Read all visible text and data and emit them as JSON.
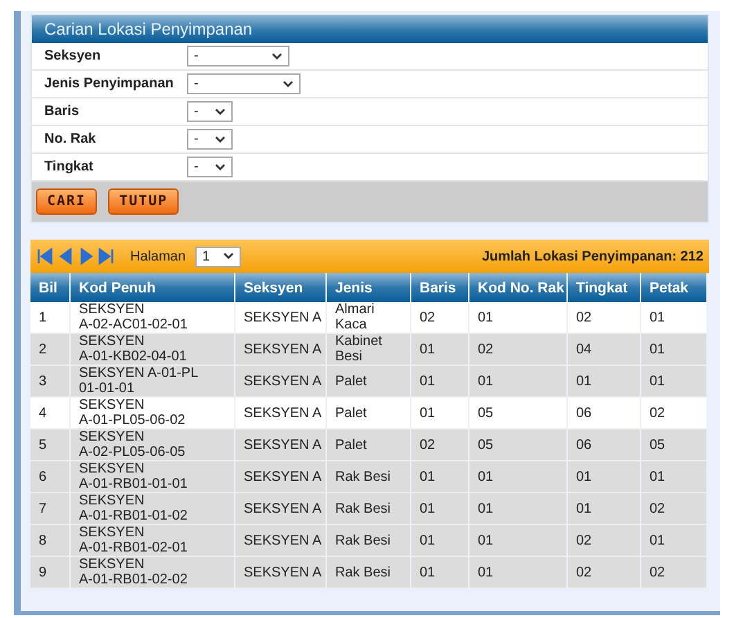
{
  "search_panel": {
    "title": "Carian Lokasi Penyimpanan",
    "fields": [
      {
        "label": "Seksyen",
        "value": "-"
      },
      {
        "label": "Jenis Penyimpanan",
        "value": "-"
      },
      {
        "label": "Baris",
        "value": "-"
      },
      {
        "label": "No. Rak",
        "value": "-"
      },
      {
        "label": "Tingkat",
        "value": "-"
      }
    ],
    "buttons": [
      "CARI",
      "TUTUP"
    ]
  },
  "pager": {
    "page_label": "Halaman",
    "page": "1",
    "total": "Jumlah Lokasi Penyimpanan: 212"
  },
  "table": {
    "columns": [
      "Bil",
      "Kod Penuh",
      "Seksyen",
      "Jenis",
      "Baris",
      "Kod No. Rak",
      "Tingkat",
      "Petak"
    ],
    "rows": [
      {
        "highlighted": true,
        "cells": [
          "1",
          "SEKSYEN\nA-02-AC01-02-01",
          "SEKSYEN A",
          "Almari\nKaca",
          "02",
          "01",
          "02",
          "01"
        ]
      },
      {
        "highlighted": false,
        "cells": [
          "2",
          "SEKSYEN\nA-01-KB02-04-01",
          "SEKSYEN A",
          "Kabinet\nBesi",
          "01",
          "02",
          "04",
          "01"
        ]
      },
      {
        "highlighted": false,
        "cells": [
          "3",
          "SEKSYEN A-01-PL\n01-01-01",
          "SEKSYEN A",
          "Palet",
          "01",
          "01",
          "01",
          "01"
        ]
      },
      {
        "highlighted": true,
        "cells": [
          "4",
          "SEKSYEN\nA-01-PL05-06-02",
          "SEKSYEN A",
          "Palet",
          "01",
          "05",
          "06",
          "02"
        ]
      },
      {
        "highlighted": false,
        "cells": [
          "5",
          "SEKSYEN\nA-02-PL05-06-05",
          "SEKSYEN A",
          "Palet",
          "02",
          "05",
          "06",
          "05"
        ]
      },
      {
        "highlighted": false,
        "cells": [
          "6",
          "SEKSYEN\nA-01-RB01-01-01",
          "SEKSYEN A",
          "Rak Besi",
          "01",
          "01",
          "01",
          "01"
        ]
      },
      {
        "highlighted": false,
        "cells": [
          "7",
          "SEKSYEN\nA-01-RB01-01-02",
          "SEKSYEN A",
          "Rak Besi",
          "01",
          "01",
          "01",
          "02"
        ]
      },
      {
        "highlighted": false,
        "cells": [
          "8",
          "SEKSYEN\nA-01-RB01-02-01",
          "SEKSYEN A",
          "Rak Besi",
          "01",
          "01",
          "02",
          "01"
        ]
      },
      {
        "highlighted": false,
        "cells": [
          "9",
          "SEKSYEN\nA-01-RB01-02-02",
          "SEKSYEN A",
          "Rak Besi",
          "01",
          "01",
          "02",
          "02"
        ]
      }
    ]
  }
}
